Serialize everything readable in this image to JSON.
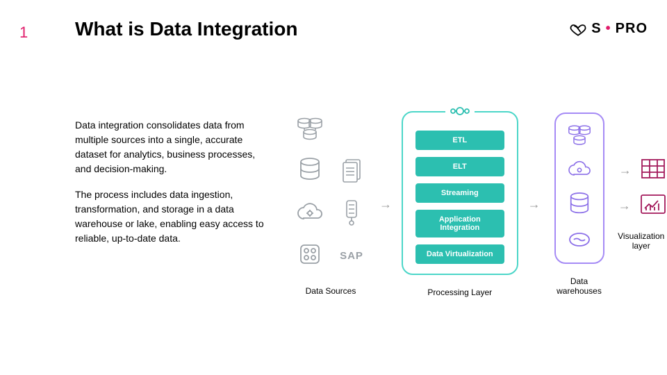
{
  "slide_number": "1",
  "title": "What is Data Integration",
  "logo": {
    "brand_left": "S",
    "brand_right": "PRO"
  },
  "paragraphs": [
    "Data integration consolidates data from multiple sources into a single, accurate dataset for analytics, business processes, and decision-making.",
    "The process includes data ingestion, transformation, and storage in a data warehouse or lake, enabling easy access to reliable, up-to-date data."
  ],
  "columns": {
    "sources_label": "Data Sources",
    "processing_label": "Processing Layer",
    "warehouse_label": "Data warehouses",
    "viz_label": "Visualization layer"
  },
  "sources": {
    "sap_label": "SAP"
  },
  "processing_items": [
    "ETL",
    "ELT",
    "Streaming",
    "Application Integration",
    "Data Virtualization"
  ]
}
